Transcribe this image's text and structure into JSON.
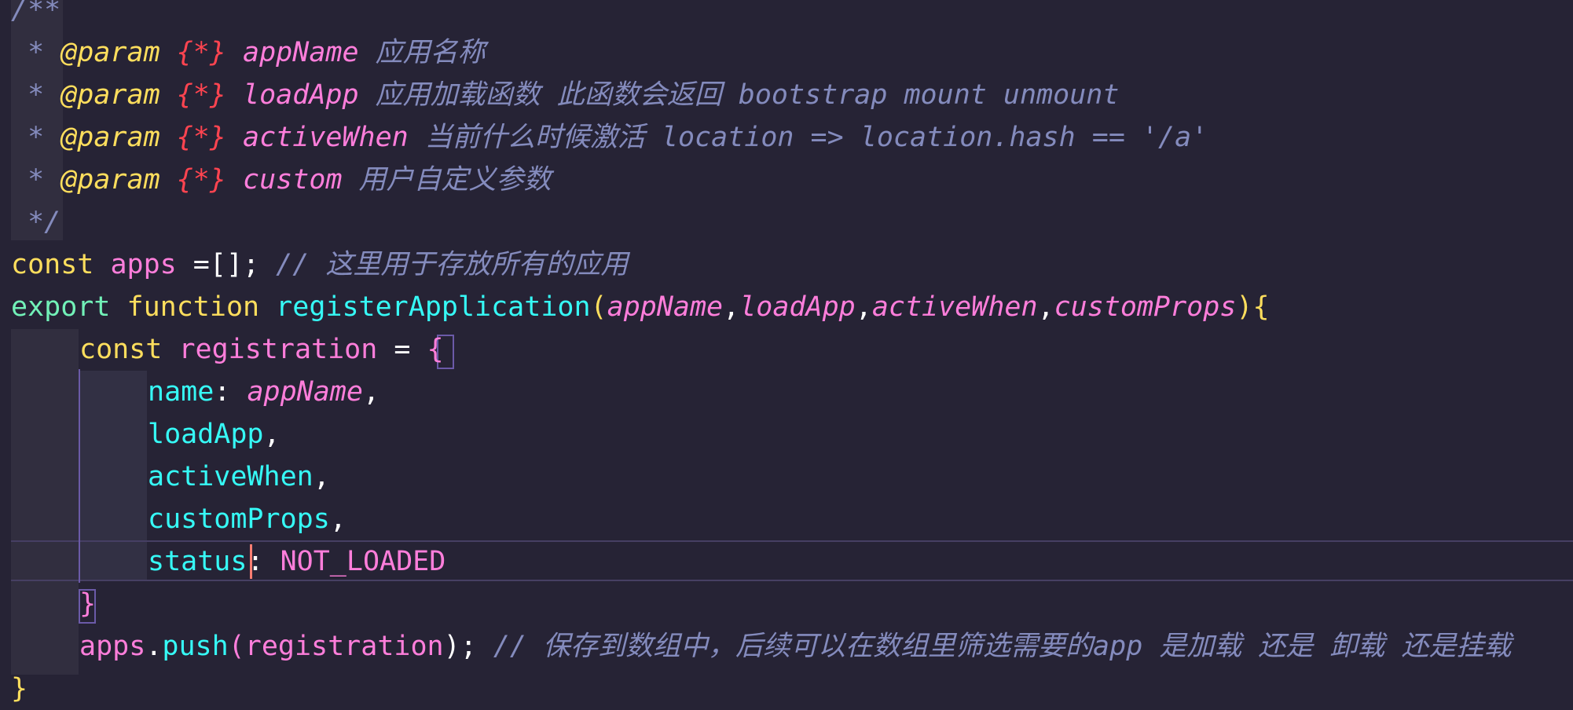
{
  "code": {
    "doc_open": "/**",
    "doc_star": " * ",
    "doc_close": " */",
    "at_param": "@param",
    "any_type": "{*}",
    "params": [
      {
        "name": "appName",
        "desc": "应用名称"
      },
      {
        "name": "loadApp",
        "desc": "应用加载函数 此函数会返回 bootstrap mount unmount"
      },
      {
        "name": "activeWhen",
        "desc": "当前什么时候激活 location => location.hash == '/a'"
      },
      {
        "name": "custom",
        "desc": "用户自定义参数"
      }
    ],
    "line_apps": {
      "kw": "const",
      "name": "apps",
      "rest": " =[]; ",
      "comment": "// 这里用于存放所有的应用"
    },
    "line_fn": {
      "kw_export": "export",
      "kw_function": "function",
      "name": "registerApplication",
      "open_paren": "(",
      "args": [
        "appName",
        "loadApp",
        "activeWhen",
        "customProps"
      ],
      "comma": ",",
      "close": "){"
    },
    "line_reg": {
      "kw": "const",
      "name": "registration",
      "eq": " = ",
      "open": "{"
    },
    "props": [
      {
        "key": "name",
        "sep": ": ",
        "value": "appName",
        "trail": ","
      },
      {
        "key": "loadApp",
        "trail": ","
      },
      {
        "key": "activeWhen",
        "trail": ","
      },
      {
        "key": "customProps",
        "trail": ","
      },
      {
        "key": "status",
        "sep": ": ",
        "value": "NOT_LOADED",
        "trail": ""
      }
    ],
    "close_obj": "}",
    "line_push": {
      "obj": "apps",
      "dot": ".",
      "method": "push",
      "open": "(",
      "arg": "registration",
      "close": "); ",
      "comment": "// 保存到数组中，后续可以在数组里筛选需要的app 是加载 还是 卸载 还是挂载"
    },
    "close_fn": "}"
  }
}
